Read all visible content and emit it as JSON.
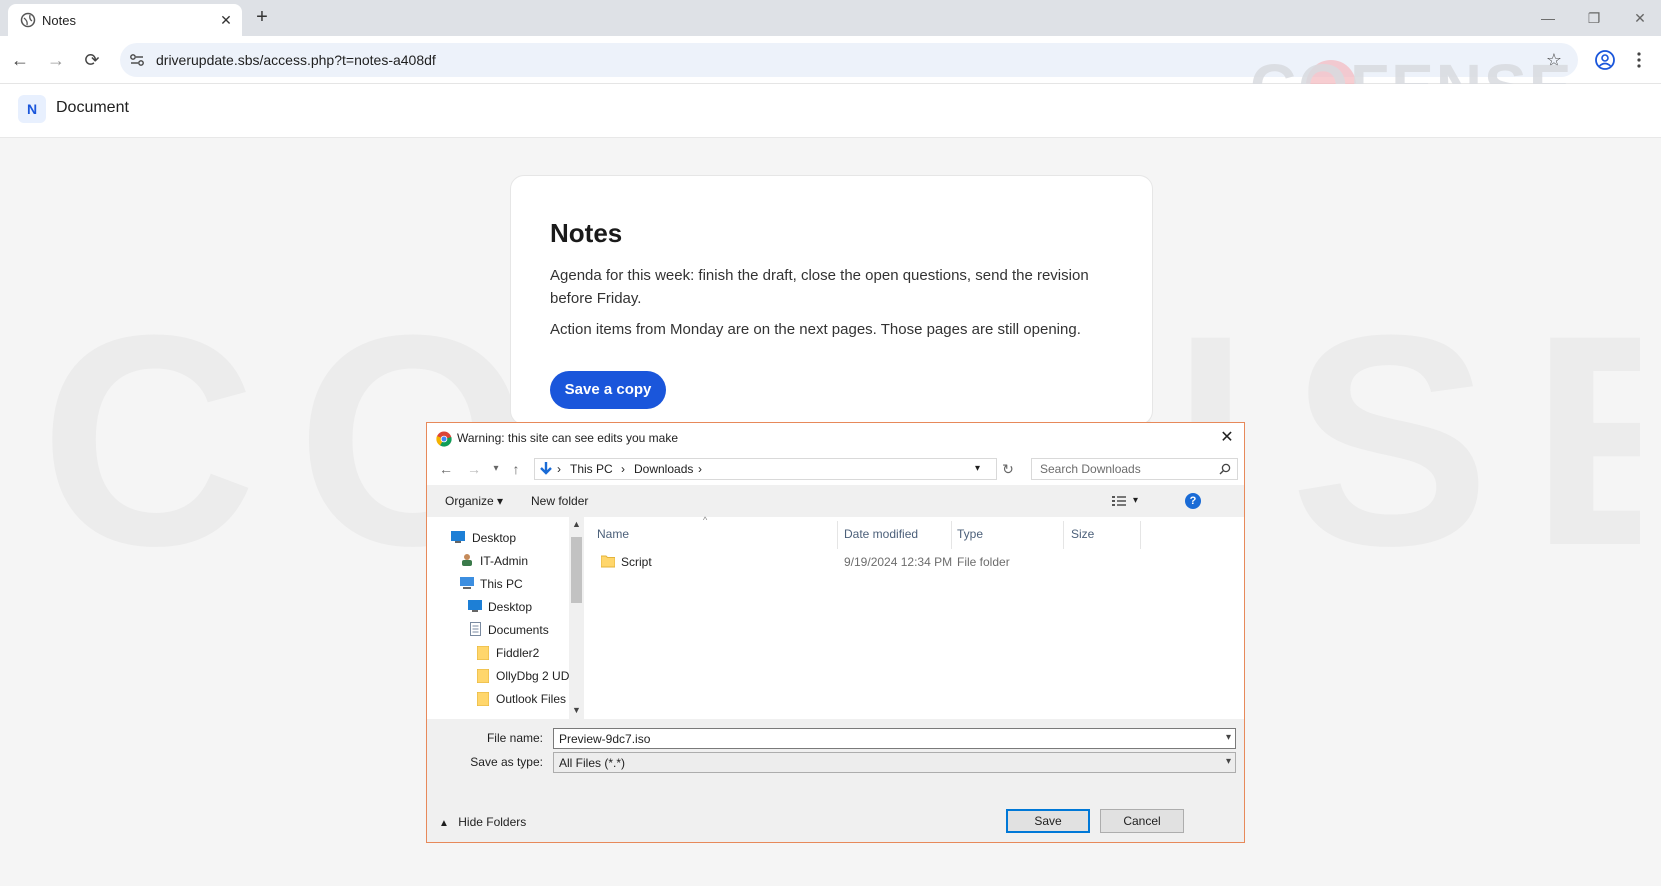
{
  "browser": {
    "tab_title": "Notes",
    "tab_close": "✕",
    "new_tab": "+",
    "url": "driverupdate.sbs/access.php?t=notes-a408df",
    "controls": {
      "minimize": "—",
      "restore": "❐",
      "close": "✕"
    },
    "nav": {
      "back": "←",
      "forward": "→",
      "reload": "⟳"
    },
    "star": "☆"
  },
  "watermark": {
    "corner": "COFENSE",
    "large": "COFENSE"
  },
  "page": {
    "logo_letter": "N",
    "header_title": "Document",
    "card": {
      "title": "Notes",
      "paragraph1": "Agenda for this week: finish the draft, close the open questions, send the revision before Friday.",
      "paragraph2": "Action items from Monday are on the next pages. Those pages are still opening.",
      "button": "Save a copy"
    }
  },
  "dialog": {
    "title": "Warning: this site can see edits you make",
    "close": "✕",
    "breadcrumb": [
      "This PC",
      "Downloads"
    ],
    "search_placeholder": "Search Downloads",
    "toolbar": {
      "organize": "Organize ▾",
      "new_folder": "New folder",
      "help": "?"
    },
    "nav_tree": [
      {
        "label": "Desktop",
        "icon": "desktop-icon"
      },
      {
        "label": "IT-Admin",
        "icon": "user-icon"
      },
      {
        "label": "This PC",
        "icon": "computer-icon"
      },
      {
        "label": "Desktop",
        "icon": "desktop-icon"
      },
      {
        "label": "Documents",
        "icon": "documents-icon"
      },
      {
        "label": "Fiddler2",
        "icon": "folder-icon"
      },
      {
        "label": "OllyDbg 2 UD",
        "icon": "folder-icon"
      },
      {
        "label": "Outlook Files",
        "icon": "folder-icon"
      }
    ],
    "columns": [
      "Name",
      "Date modified",
      "Type",
      "Size"
    ],
    "files": [
      {
        "name": "Script",
        "date": "9/19/2024 12:34 PM",
        "type": "File folder",
        "size": ""
      }
    ],
    "file_name_label": "File name:",
    "file_name_value": "Preview-9dc7.iso",
    "save_type_label": "Save as type:",
    "save_type_value": "All Files (*.*)",
    "hide_folders": "Hide Folders",
    "save_button": "Save",
    "cancel_button": "Cancel"
  },
  "colors": {
    "accent": "#1a56db",
    "dialog_border": "#e7895a",
    "default_button": "#0078d7"
  }
}
